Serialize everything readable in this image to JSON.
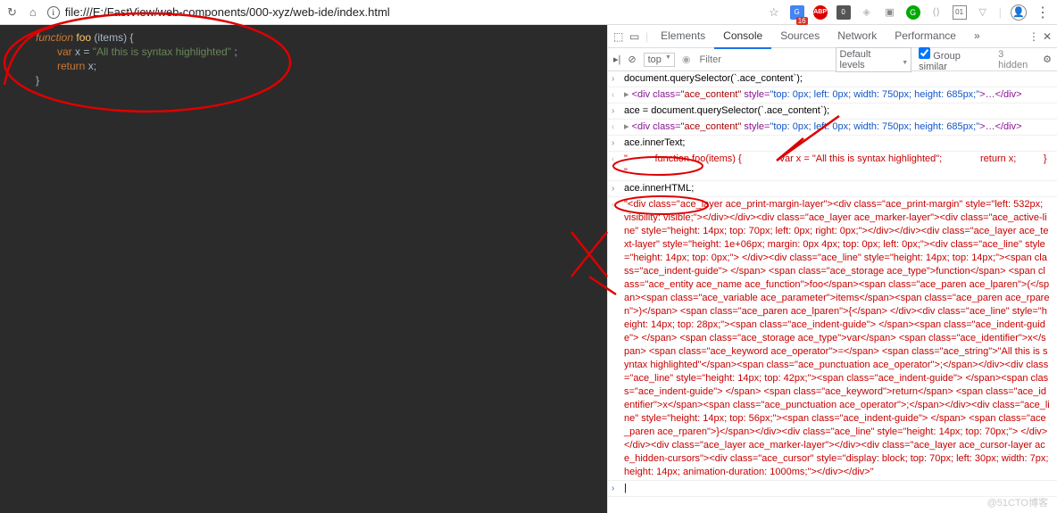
{
  "browser": {
    "url": "file:///E:/FastView/web-components/000-xyz/web-ide/index.html",
    "ext_badge1": "16",
    "ext_badge2": "0",
    "ext_badge3": "01"
  },
  "editor": {
    "line1_fn": "function",
    "line1_name": "foo",
    "line1_params": "(items) {",
    "line2_var": "var",
    "line2_x": " x ",
    "line2_eq": "= ",
    "line2_str": "\"All this is syntax highlighted\"",
    "line2_semi": ";",
    "line3_ret": "return",
    "line3_x": " x;",
    "line4": "}"
  },
  "devtools": {
    "tabs": [
      "Elements",
      "Console",
      "Sources",
      "Network",
      "Performance"
    ],
    "active_tab": "Console",
    "top": "top",
    "filter_ph": "Filter",
    "levels": "Default levels",
    "group": "Group similar",
    "hidden": "3 hidden"
  },
  "console": {
    "r1": "document.querySelector(`.ace_content`);",
    "r2a": "<div class=",
    "r2b": "\"ace_content\"",
    "r2c": " style=",
    "r2d": "\"top: 0px; left: 0px; width: 750px; height: 685px;\"",
    "r2e": ">…</div>",
    "r3": "ace = document.querySelector(`.ace_content`);",
    "r5": "ace.innerText;",
    "r6a": "\"          function foo(items) {              var x = \"All this is syntax highlighted\";              return x;          }          \"",
    "r7": "ace.innerHTML;",
    "r8": "\"<div class=\"ace_layer ace_print-margin-layer\"><div class=\"ace_print-margin\" style=\"left: 532px; visibility: visible;\"></div></div><div class=\"ace_layer ace_marker-layer\"><div class=\"ace_active-line\" style=\"height: 14px; top: 70px; left: 0px; right: 0px;\"></div></div><div class=\"ace_layer ace_text-layer\" style=\"height: 1e+06px; margin: 0px 4px; top: 0px; left: 0px;\"><div class=\"ace_line\" style=\"height: 14px; top: 0px;\">    </div><div class=\"ace_line\" style=\"height: 14px; top: 14px;\"><span class=\"ace_indent-guide\">    </span>    <span class=\"ace_storage ace_type\">function</span> <span class=\"ace_entity ace_name ace_function\">foo</span><span class=\"ace_paren ace_lparen\">(</span><span class=\"ace_variable ace_parameter\">items</span><span class=\"ace_paren ace_rparen\">)</span> <span class=\"ace_paren ace_lparen\">{</span> </div><div class=\"ace_line\" style=\"height: 14px; top: 28px;\"><span class=\"ace_indent-guide\">    </span><span class=\"ace_indent-guide\">    </span>    <span class=\"ace_storage ace_type\">var</span> <span class=\"ace_identifier\">x</span> <span class=\"ace_keyword ace_operator\">=</span> <span class=\"ace_string\">\"All this is syntax highlighted\"</span><span class=\"ace_punctuation ace_operator\">;</span></div><div class=\"ace_line\" style=\"height: 14px; top: 42px;\"><span class=\"ace_indent-guide\">    </span><span class=\"ace_indent-guide\">    </span>    <span class=\"ace_keyword\">return</span> <span class=\"ace_identifier\">x</span><span class=\"ace_punctuation ace_operator\">;</span></div><div class=\"ace_line\" style=\"height: 14px; top: 56px;\"><span class=\"ace_indent-guide\">    </span>    <span class=\"ace_paren ace_rparen\">}</span></div><div class=\"ace_line\" style=\"height: 14px; top: 70px;\">    </div></div><div class=\"ace_layer ace_marker-layer\"></div><div class=\"ace_layer ace_cursor-layer ace_hidden-cursors\"><div class=\"ace_cursor\" style=\"display: block; top: 70px; left: 30px; width: 7px; height: 14px; animation-duration: 1000ms;\"></div></div>\"",
    "prompt": ""
  },
  "watermark": "@51CTO博客"
}
